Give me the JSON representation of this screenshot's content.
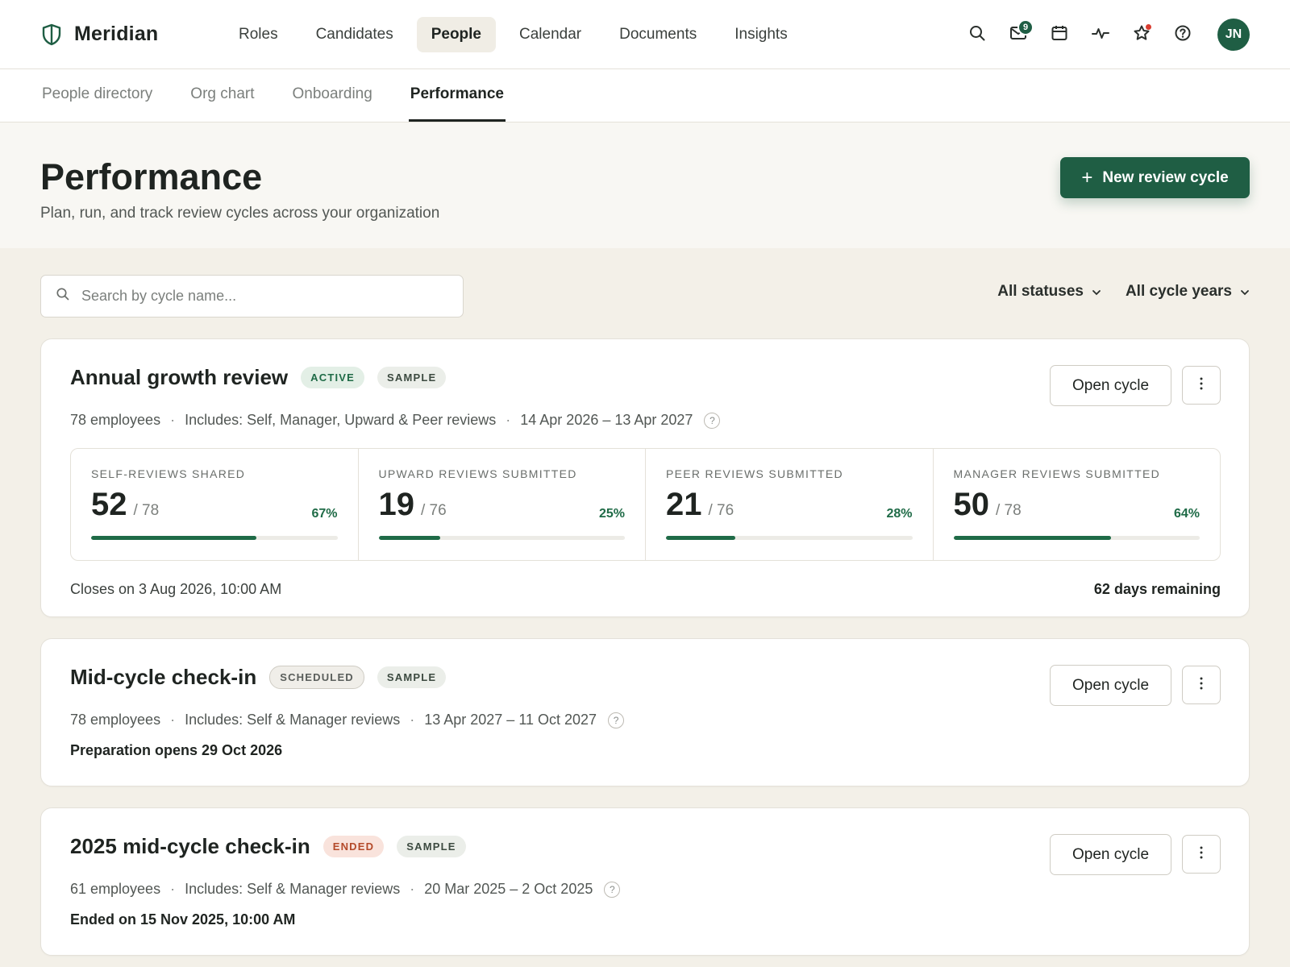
{
  "app": {
    "name": "Meridian"
  },
  "nav": {
    "items": [
      {
        "label": "Roles",
        "active": false
      },
      {
        "label": "Candidates",
        "active": false
      },
      {
        "label": "People",
        "active": true
      },
      {
        "label": "Calendar",
        "active": false
      },
      {
        "label": "Documents",
        "active": false
      },
      {
        "label": "Insights",
        "active": false
      }
    ],
    "inbox_count": "9",
    "avatar_initials": "JN"
  },
  "subnav": {
    "items": [
      {
        "label": "People directory",
        "active": false
      },
      {
        "label": "Org chart",
        "active": false
      },
      {
        "label": "Onboarding",
        "active": false
      },
      {
        "label": "Performance",
        "active": true
      }
    ]
  },
  "header": {
    "title": "Performance",
    "subtitle": "Plan, run, and track review cycles across your organization",
    "new_button": "New review cycle"
  },
  "filters": {
    "search_placeholder": "Search by cycle name...",
    "status": "All statuses",
    "years": "All cycle years"
  },
  "cycles": [
    {
      "title": "Annual growth review",
      "status": "Active",
      "tag": "Sample",
      "employees": "78 employees",
      "includes": "Includes: Self, Manager, Upward & Peer reviews",
      "dates": "14 Apr 2026 – 13 Apr 2027",
      "open_label": "Open cycle",
      "stats": [
        {
          "label": "Self-reviews shared",
          "value": "52",
          "total": "/ 78",
          "pct": "67%",
          "fraction": 0.67
        },
        {
          "label": "Upward reviews submitted",
          "value": "19",
          "total": "/ 76",
          "pct": "25%",
          "fraction": 0.25
        },
        {
          "label": "Peer reviews submitted",
          "value": "21",
          "total": "/ 76",
          "pct": "28%",
          "fraction": 0.28
        },
        {
          "label": "Manager reviews submitted",
          "value": "50",
          "total": "/ 78",
          "pct": "64%",
          "fraction": 0.64
        }
      ],
      "closes": "Closes on 3 Aug 2026, 10:00 AM",
      "remaining": "62 days remaining"
    },
    {
      "title": "Mid-cycle check-in",
      "status": "Scheduled",
      "tag": "Sample",
      "employees": "78 employees",
      "includes": "Includes: Self & Manager reviews",
      "dates": "13 Apr 2027 – 11 Oct 2027",
      "open_label": "Open cycle",
      "note": "Preparation opens 29 Oct 2026"
    },
    {
      "title": "2025 mid-cycle check-in",
      "status": "Ended",
      "tag": "Sample",
      "employees": "61 employees",
      "includes": "Includes: Self & Manager reviews",
      "dates": "20 Mar 2025 – 2 Oct 2025",
      "open_label": "Open cycle",
      "note": "Ended on 15 Nov 2025, 10:00 AM"
    }
  ],
  "colors": {
    "brand": "#1f5e44",
    "accent": "#1f6b47",
    "ended": "#b44a2a",
    "notification": "#d93c2f"
  }
}
